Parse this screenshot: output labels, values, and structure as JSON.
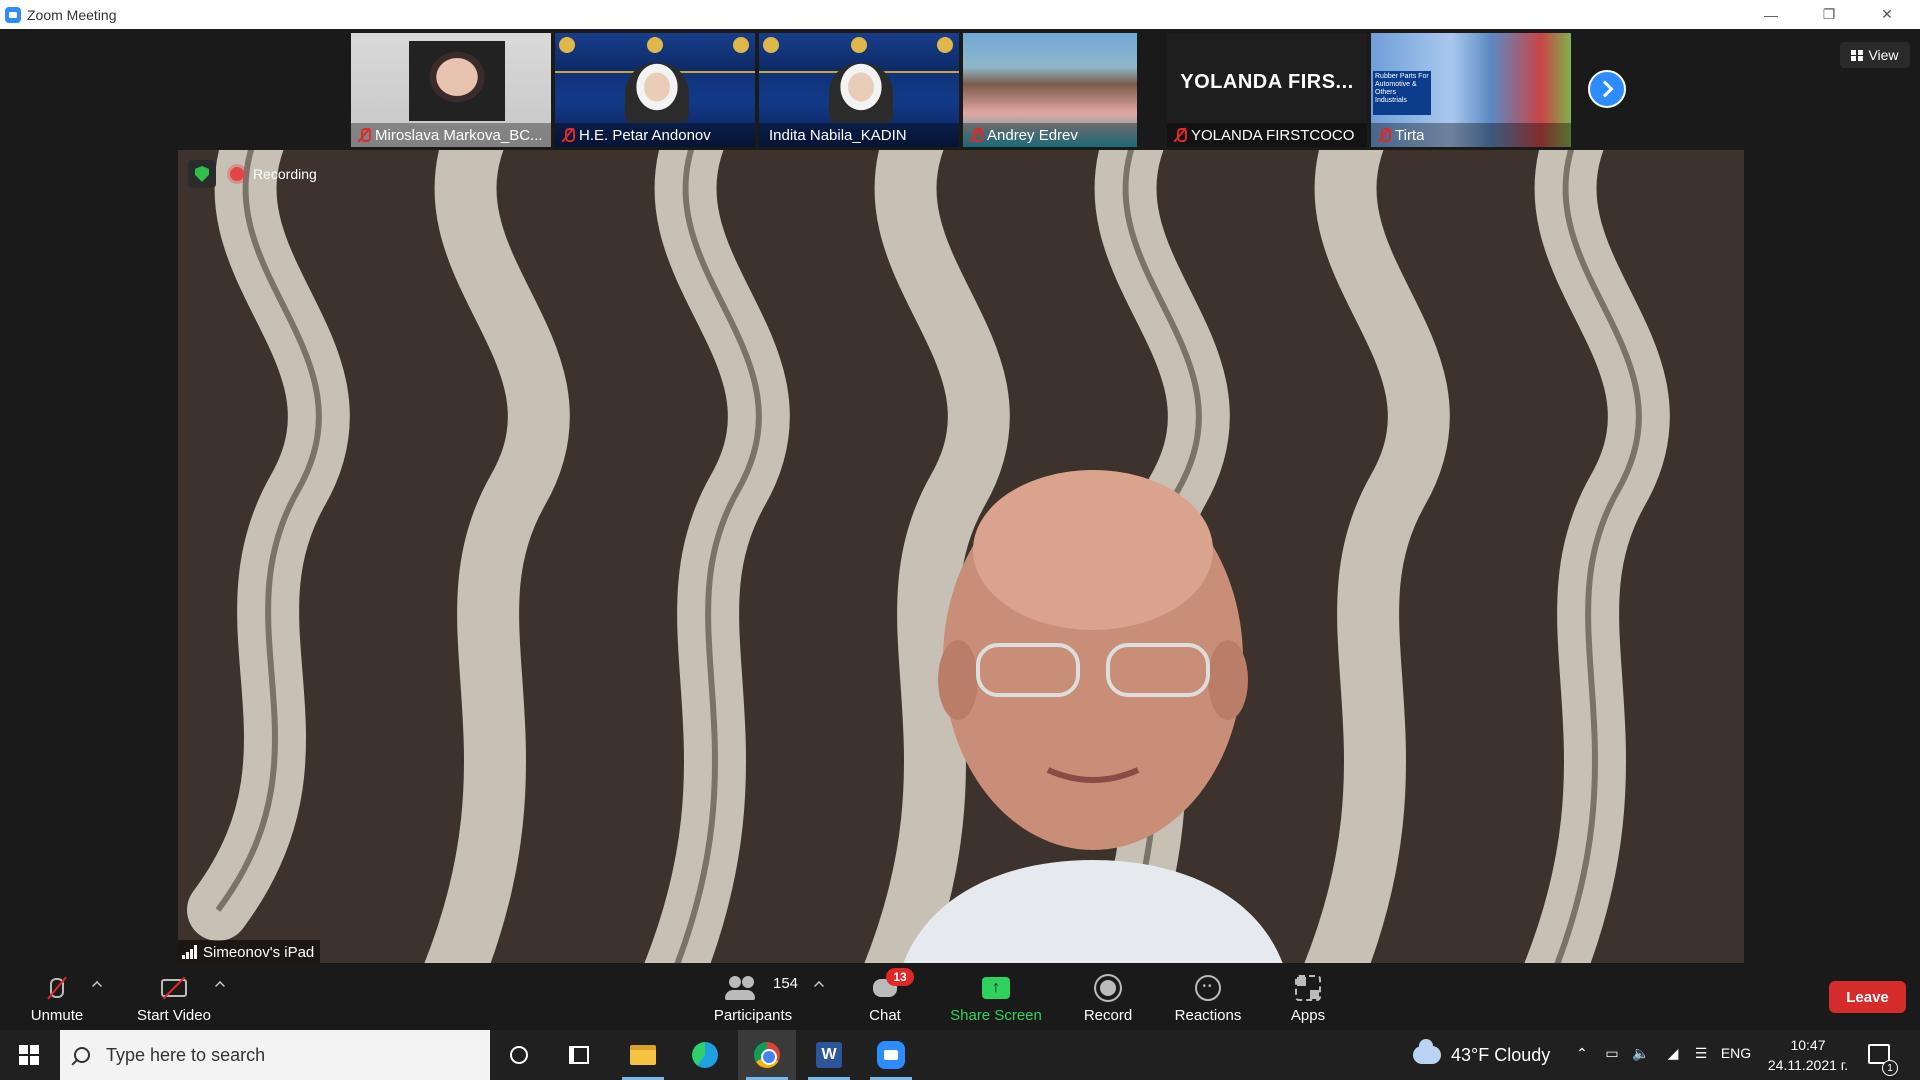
{
  "window": {
    "title": "Zoom Meeting",
    "minimize": "—",
    "restore": "❐",
    "close": "✕"
  },
  "thumbnails": [
    {
      "name": "Miroslava Markova_BC...",
      "muted": true,
      "tile": "photo"
    },
    {
      "name": "H.E. Petar Andonov",
      "muted": true,
      "tile": "banner"
    },
    {
      "name": "Indita Nabila_KADIN",
      "muted": false,
      "tile": "banner"
    },
    {
      "name": "Andrey Edrev",
      "muted": true,
      "tile": "beach"
    },
    {
      "name": "YOLANDA FIRSTCOCO",
      "muted": true,
      "tile": "text",
      "big_name": "YOLANDA FIRS..."
    },
    {
      "name": "Tirta",
      "muted": true,
      "tile": "factory",
      "sign_text": "Rubber Parts For Automotive & Others Industrials"
    }
  ],
  "view_button": {
    "label": "View",
    "icon": "grid-icon"
  },
  "main_video": {
    "recording_label": "Recording",
    "speaker_name": "Simeonov's iPad"
  },
  "controls": {
    "unmute": "Unmute",
    "start_video": "Start Video",
    "participants": "Participants",
    "participants_count": "154",
    "chat": "Chat",
    "chat_badge": "13",
    "share_screen": "Share Screen",
    "record": "Record",
    "reactions": "Reactions",
    "apps": "Apps",
    "leave": "Leave"
  },
  "taskbar": {
    "search_placeholder": "Type here to search",
    "word_letter": "W",
    "weather": "43°F  Cloudy",
    "language": "ENG",
    "time": "10:47",
    "date": "24.11.2021 г.",
    "notification_count": "1"
  },
  "colors": {
    "zoom_blue": "#2d8cff",
    "leave_red": "#d42b2b",
    "share_green": "#2dd25e",
    "muted_red": "#e02828"
  }
}
